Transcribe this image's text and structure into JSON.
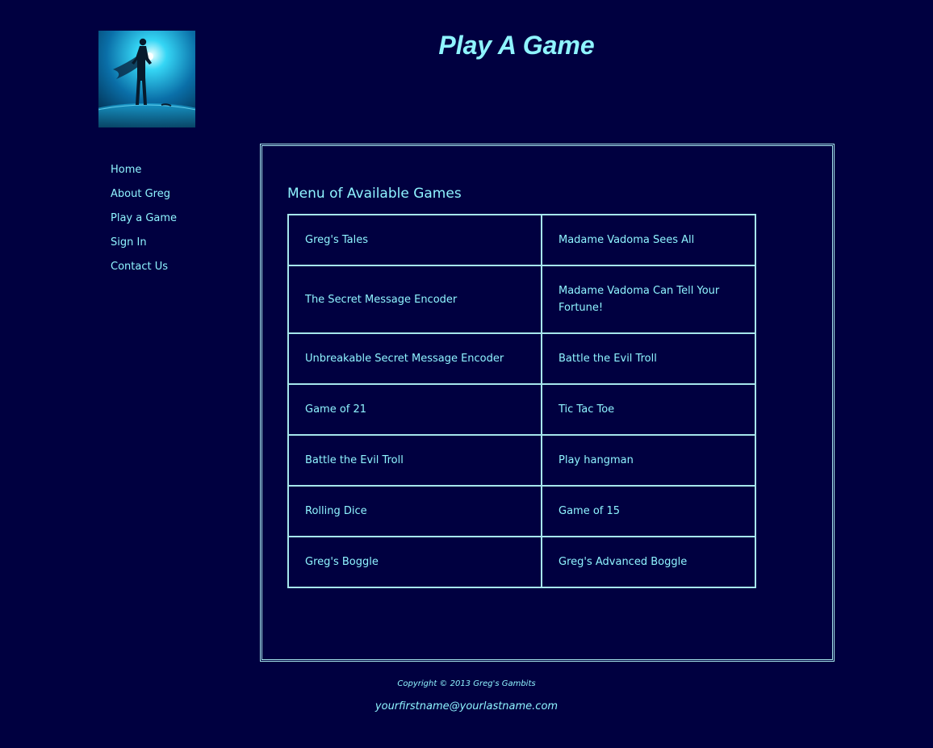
{
  "header": {
    "title": "Play A Game",
    "logo_icon": "superhero-silhouette-icon"
  },
  "nav": {
    "items": [
      {
        "label": "Home"
      },
      {
        "label": "About Greg"
      },
      {
        "label": "Play a Game"
      },
      {
        "label": "Sign In"
      },
      {
        "label": "Contact Us"
      }
    ]
  },
  "main": {
    "heading": "Menu of Available Games",
    "games": [
      [
        "Greg's Tales",
        "Madame Vadoma Sees All"
      ],
      [
        "The Secret Message Encoder",
        "Madame Vadoma Can Tell Your Fortune!"
      ],
      [
        "Unbreakable Secret Message Encoder",
        "Battle the Evil Troll"
      ],
      [
        "Game of 21",
        "Tic Tac Toe"
      ],
      [
        "Battle the Evil Troll",
        "Play hangman"
      ],
      [
        "Rolling Dice",
        "Game of 15"
      ],
      [
        "Greg's Boggle",
        "Greg's Advanced Boggle"
      ]
    ]
  },
  "footer": {
    "copyright": "Copyright © 2013 Greg's Gambits",
    "email": "yourfirstname@yourlastname.com"
  },
  "colors": {
    "background": "#000040",
    "text": "#8ff4ff",
    "border": "#a6e6ec"
  }
}
